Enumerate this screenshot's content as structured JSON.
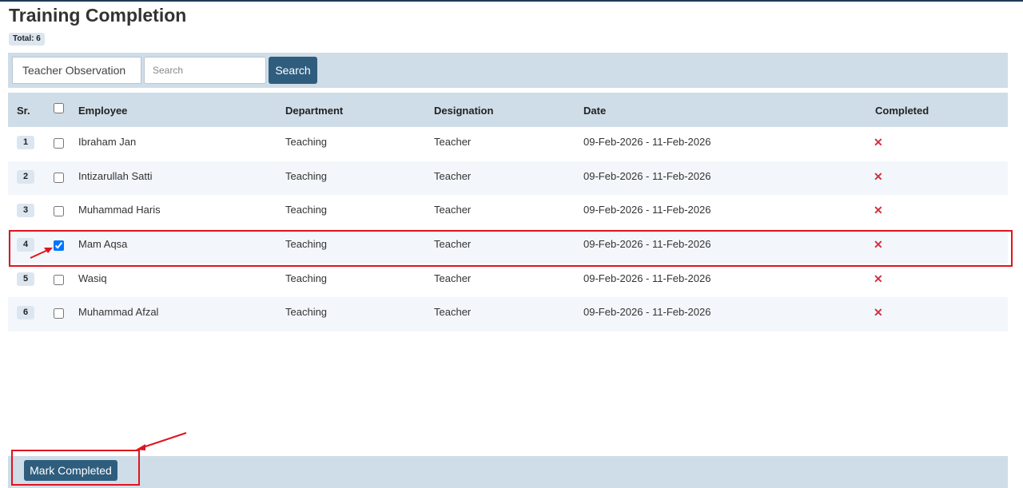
{
  "page": {
    "title": "Training Completion",
    "total_label": "Total: 6"
  },
  "filter": {
    "training_select_value": "Teacher Observation",
    "search_placeholder": "Search",
    "search_button_label": "Search"
  },
  "table": {
    "headers": {
      "sr": "Sr.",
      "employee": "Employee",
      "department": "Department",
      "designation": "Designation",
      "date": "Date",
      "completed": "Completed"
    },
    "rows": [
      {
        "sr": "1",
        "employee": "Ibraham Jan",
        "department": "Teaching",
        "designation": "Teacher",
        "date": "09-Feb-2026 - 11-Feb-2026",
        "completed": "✕",
        "checked": false
      },
      {
        "sr": "2",
        "employee": "Intizarullah Satti",
        "department": "Teaching",
        "designation": "Teacher",
        "date": "09-Feb-2026 - 11-Feb-2026",
        "completed": "✕",
        "checked": false
      },
      {
        "sr": "3",
        "employee": "Muhammad Haris",
        "department": "Teaching",
        "designation": "Teacher",
        "date": "09-Feb-2026 - 11-Feb-2026",
        "completed": "✕",
        "checked": false
      },
      {
        "sr": "4",
        "employee": "Mam Aqsa",
        "department": "Teaching",
        "designation": "Teacher",
        "date": "09-Feb-2026 - 11-Feb-2026",
        "completed": "✕",
        "checked": true
      },
      {
        "sr": "5",
        "employee": "Wasiq",
        "department": "Teaching",
        "designation": "Teacher",
        "date": "09-Feb-2026 - 11-Feb-2026",
        "completed": "✕",
        "checked": false
      },
      {
        "sr": "6",
        "employee": "Muhammad Afzal",
        "department": "Teaching",
        "designation": "Teacher",
        "date": "09-Feb-2026 - 11-Feb-2026",
        "completed": "✕",
        "checked": false
      }
    ]
  },
  "footer": {
    "mark_completed_label": "Mark Completed"
  },
  "colors": {
    "primary_button": "#2f5d7e",
    "bar_background": "#cfdde8",
    "not_completed_mark": "#d32f3f",
    "annotation_red": "#e0141e"
  }
}
